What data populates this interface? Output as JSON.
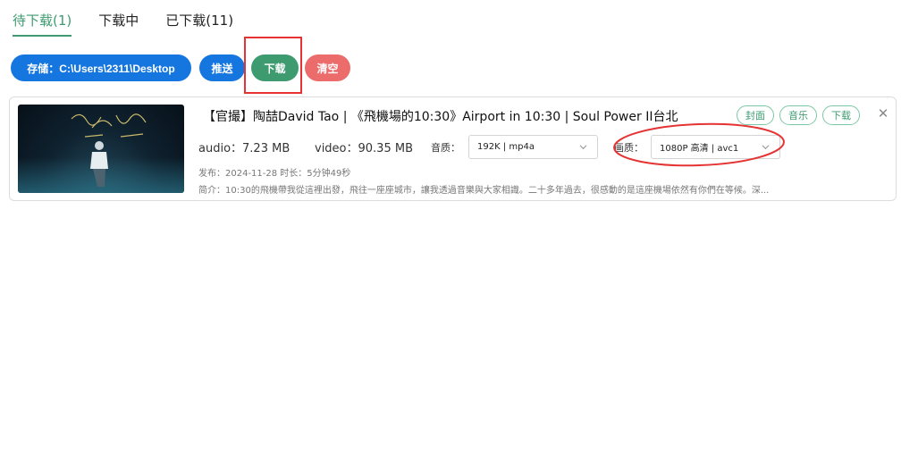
{
  "tabs": [
    {
      "label": "待下载(1)",
      "active": true
    },
    {
      "label": "下载中",
      "active": false
    },
    {
      "label": "已下载(11)",
      "active": false
    }
  ],
  "toolbar": {
    "path_label": "存储：C:\\Users\\2311\\Desktop",
    "push_label": "推送",
    "download_label": "下载",
    "clear_label": "清空"
  },
  "item": {
    "title": "【官撮】陶喆David Tao | 《飛機場的10:30》Airport in 10:30 | Soul Power II台北",
    "tags": [
      "封面",
      "音乐",
      "下载"
    ],
    "close_glyph": "✕",
    "audio_size": "audio：7.23 MB",
    "video_size": "video：90.35 MB",
    "audio_quality_label": "音质：",
    "audio_quality_value": "192K | mp4a",
    "video_quality_label": "画质：",
    "video_quality_value": "1080P 高清 | avc1",
    "meta": "发布：2024-11-28 时长：5分钟49秒",
    "description": "简介：10:30的飛機帶我從這裡出發，飛往一座座城市，讓我透過音樂與大家相識。二十多年過去，很感動的是這座機場依然有你們在等候。深..."
  },
  "colors": {
    "accent_green": "#3d9b6f",
    "blue": "#1676e0",
    "red": "#ec6b6b",
    "annotation_red": "#e53333"
  },
  "icons": {
    "close": "close-icon",
    "chevron": "chevron-down-icon"
  }
}
